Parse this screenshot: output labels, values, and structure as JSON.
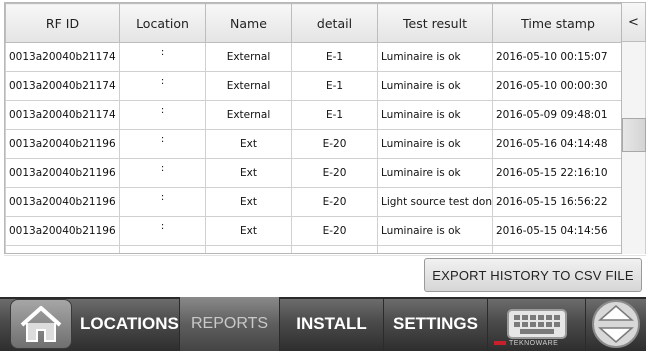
{
  "table": {
    "columns": [
      "RF ID",
      "Location",
      "Name",
      "detail",
      "Test result",
      "Time stamp",
      "<"
    ],
    "rows": [
      {
        "rf_id": "0013a20040b21174",
        "location": ":",
        "name": "External",
        "detail": "E-1",
        "result": "Luminaire is ok",
        "timestamp": "2016-05-10 00:15:07"
      },
      {
        "rf_id": "0013a20040b21174",
        "location": ":",
        "name": "External",
        "detail": "E-1",
        "result": "Luminaire is ok",
        "timestamp": "2016-05-10 00:00:30"
      },
      {
        "rf_id": "0013a20040b21174",
        "location": ":",
        "name": "External",
        "detail": "E-1",
        "result": "Luminaire is ok",
        "timestamp": "2016-05-09 09:48:01"
      },
      {
        "rf_id": "0013a20040b21196",
        "location": ":",
        "name": "Ext",
        "detail": "E-20",
        "result": "Luminaire is ok",
        "timestamp": "2016-05-16 04:14:48"
      },
      {
        "rf_id": "0013a20040b21196",
        "location": ":",
        "name": "Ext",
        "detail": "E-20",
        "result": "Luminaire is ok",
        "timestamp": "2016-05-15 22:16:10"
      },
      {
        "rf_id": "0013a20040b21196",
        "location": ":",
        "name": "Ext",
        "detail": "E-20",
        "result": "Light source test done",
        "timestamp": "2016-05-15 16:56:22"
      },
      {
        "rf_id": "0013a20040b21196",
        "location": ":",
        "name": "Ext",
        "detail": "E-20",
        "result": "Luminaire is ok",
        "timestamp": "2016-05-15 04:14:56"
      },
      {
        "rf_id": "",
        "location": "",
        "name": "",
        "detail": "",
        "result": "",
        "timestamp": ""
      }
    ]
  },
  "actions": {
    "export_label": "EXPORT HISTORY TO CSV FILE"
  },
  "nav": {
    "home_icon": "home-icon",
    "locations": "LOCATIONS",
    "reports": "REPORTS",
    "install": "INSTALL",
    "settings": "SETTINGS",
    "keyboard_icon": "keyboard-icon",
    "arrows_icon": "up-down-arrows-icon"
  },
  "brand": {
    "name": "TEKNOWARE",
    "accent_color": "#c8202a"
  }
}
